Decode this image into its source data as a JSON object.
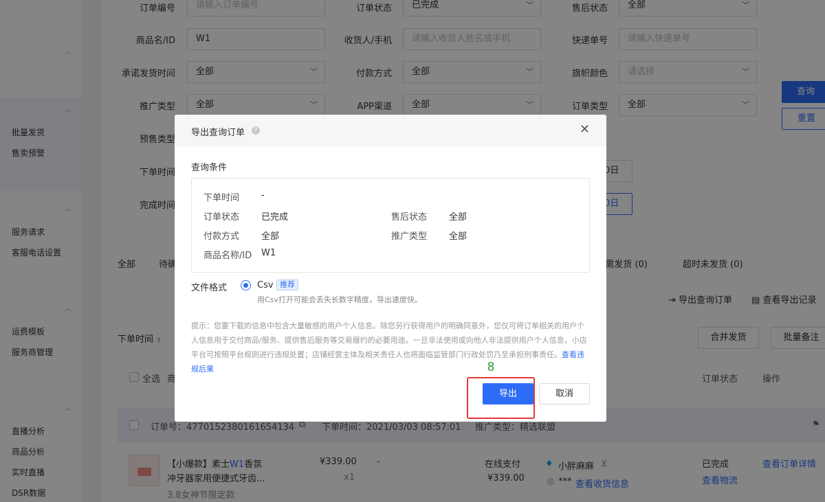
{
  "sidebar": {
    "items": [
      "批量发货",
      "售卖预警",
      "服务请求",
      "客服电话设置",
      "运费模板",
      "服务商管理",
      "直播分析",
      "商品分析",
      "实时直播",
      "DSR数据"
    ]
  },
  "filters": {
    "order_no_label": "订单编号",
    "order_no_ph": "请输入订单编号",
    "order_status_label": "订单状态",
    "order_status_value": "已完成",
    "after_sale_label": "售后状态",
    "after_sale_value": "全部",
    "product_label": "商品名/ID",
    "product_value": "W1",
    "receiver_label": "收货人/手机",
    "receiver_ph": "请输入收货人姓名或手机",
    "express_label": "快递单号",
    "express_ph": "请输入快递单号",
    "promise_label": "承诺发货时间",
    "promise_value": "全部",
    "pay_label": "付款方式",
    "pay_value": "全部",
    "flag_label": "旗帜颜色",
    "flag_ph": "请选择",
    "promo_label": "推广类型",
    "promo_value": "全部",
    "app_label": "APP渠道",
    "app_value": "全部",
    "ordertype_label": "订单类型",
    "ordertype_value": "全部",
    "presale_label": "预售类型",
    "ordertime_label": "下单时间",
    "finish_label": "完成时间",
    "date_partial_1": "0日",
    "date_partial_2": "0日",
    "query_btn": "查询",
    "reset_btn": "重置"
  },
  "tabs": {
    "all": "全部",
    "pending_partial": "待确",
    "need_ship": "h需发货 (0)",
    "overtime": "超时未发货 (0)"
  },
  "actions": {
    "export_query": "导出查询订单",
    "view_export": "查看导出记录",
    "sort_label": "下单时间",
    "merge_ship": "合并发货",
    "batch_note": "批量备注"
  },
  "table": {
    "select_all": "全选",
    "col_partial": "商",
    "col_status": "订单状态",
    "col_op": "操作"
  },
  "order": {
    "order_no": "订单号：4770152380161654134",
    "order_time": "下单时间：2021/03/03 08:57:01",
    "promo": "推广类型：精选联盟",
    "product_prefix": "【小爆款】素士",
    "product_highlight": "W1",
    "product_suffix": "香氛",
    "product_line2": "冲牙器家用便捷式牙齿...",
    "product_tag": "3.8女神节限定款",
    "price": "¥339.00",
    "qty": "x1",
    "dash": "-",
    "pay_method": "在线支付",
    "pay_amount": "¥339.00",
    "buyer": "小胖麻麻",
    "address_mask": "***",
    "view_address": "查看收货信息",
    "status": "已完成",
    "view_logistics": "查看物流",
    "view_detail": "查看订单详情"
  },
  "modal": {
    "title": "导出查询订单",
    "section_label": "查询条件",
    "conditions": {
      "order_time_key": "下单时间",
      "order_time_val": "-",
      "order_status_key": "订单状态",
      "order_status_val": "已完成",
      "after_sale_key": "售后状态",
      "after_sale_val": "全部",
      "pay_key": "付款方式",
      "pay_val": "全部",
      "promo_key": "推广类型",
      "promo_val": "全部",
      "product_key": "商品名称/ID",
      "product_val": "W1"
    },
    "format_label": "文件格式",
    "format_option": "Csv",
    "format_badge": "推荐",
    "format_hint": "用Csv打开可能会丢失长数字精度，导出速度快。",
    "notice": "提示：您要下载的信息中包含大量敏感的用户个人信息。除您另行获得用户的明确同意外，您仅可将订单相关的用户个人信息用于交付商品/服务、提供售后服务等交易履约的必要用途。一旦非法使用或向他人非法提供用户个人信息，小店平台可按照平台规则进行违规处置；店铺经营主体及相关责任人也将面临监管部门行政处罚乃至承担刑事责任。",
    "notice_link": "查看违规后果",
    "export_btn": "导出",
    "cancel_btn": "取消"
  },
  "annotation": {
    "number": "8"
  }
}
